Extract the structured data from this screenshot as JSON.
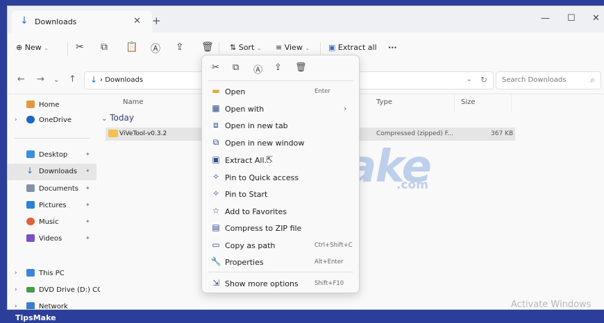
{
  "tab": {
    "label": "Downloads"
  },
  "commandbar": {
    "new": "New",
    "sort": "Sort",
    "view": "View",
    "extract_all": "Extract all",
    "more": "···"
  },
  "address": {
    "path": "Downloads",
    "search_placeholder": "Search Downloads"
  },
  "sidebar": {
    "items": [
      {
        "label": "Home"
      },
      {
        "label": "OneDrive"
      },
      {
        "label": "Desktop"
      },
      {
        "label": "Downloads"
      },
      {
        "label": "Documents"
      },
      {
        "label": "Pictures"
      },
      {
        "label": "Music"
      },
      {
        "label": "Videos"
      },
      {
        "label": "This PC"
      },
      {
        "label": "DVD Drive (D:) CCC"
      },
      {
        "label": "Network"
      }
    ]
  },
  "filelist": {
    "columns": [
      "Name",
      "Type",
      "Size"
    ],
    "group": "Today",
    "file": {
      "name": "ViVeTool-v0.3.2",
      "type": "Compressed (zipped) F...",
      "size": "367 KB"
    }
  },
  "contextmenu": {
    "items": [
      {
        "label": "Open",
        "shortcut": "Enter"
      },
      {
        "label": "Open with"
      },
      {
        "label": "Open in new tab"
      },
      {
        "label": "Open in new window"
      },
      {
        "label": "Extract All..."
      },
      {
        "label": "Pin to Quick access"
      },
      {
        "label": "Pin to Start"
      },
      {
        "label": "Add to Favorites"
      },
      {
        "label": "Compress to ZIP file"
      },
      {
        "label": "Copy as path",
        "shortcut": "Ctrl+Shift+C"
      },
      {
        "label": "Properties",
        "shortcut": "Alt+Enter"
      },
      {
        "label": "Show more options",
        "shortcut": "Shift+F10"
      }
    ]
  },
  "watermark": {
    "main": "TipsMake",
    "suffix": ".com",
    "activate": "Activate Windows"
  },
  "brand": "TipsMake"
}
